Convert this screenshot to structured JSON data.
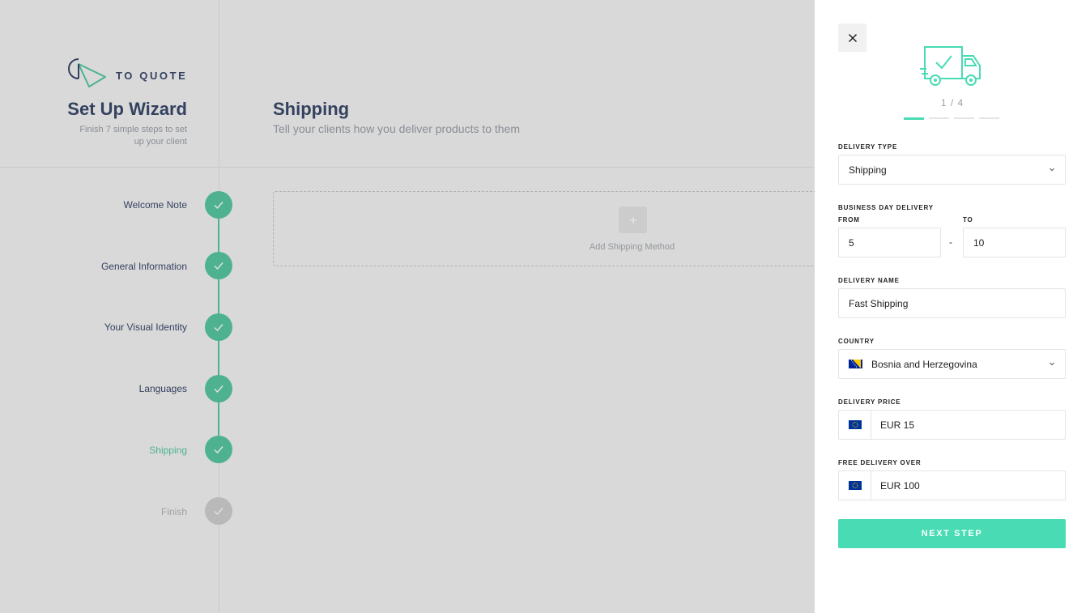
{
  "brand": {
    "logo_text": "TO QUOTE",
    "accent": "#48dbb4",
    "step_done_color": "#58c8a3",
    "navy": "#3b4a6b"
  },
  "wizard": {
    "title": "Set Up Wizard",
    "subtitle": "Finish 7 simple steps to set up your client",
    "steps": [
      {
        "label": "Welcome Note",
        "status": "done"
      },
      {
        "label": "General Information",
        "status": "done"
      },
      {
        "label": "Your Visual Identity",
        "status": "done"
      },
      {
        "label": "Languages",
        "status": "done"
      },
      {
        "label": "Shipping",
        "status": "active"
      },
      {
        "label": "Finish",
        "status": "pending"
      }
    ]
  },
  "main": {
    "title": "Shipping",
    "subtitle": "Tell your clients how you deliver products to them",
    "add_method_label": "Add Shipping Method",
    "add_icon": "plus-icon"
  },
  "drawer": {
    "close_icon": "close-icon",
    "illustration": "delivery-truck-icon",
    "counter": "1 / 4",
    "progress_current": 1,
    "progress_total": 4,
    "delivery_type": {
      "label": "DELIVERY TYPE",
      "value": "Shipping"
    },
    "business_days": {
      "label": "BUSINESS DAY DELIVERY",
      "from_label": "FROM",
      "from_value": "5",
      "separator": "-",
      "to_label": "TO",
      "to_value": "10"
    },
    "delivery_name": {
      "label": "DELIVERY NAME",
      "value": "Fast Shipping"
    },
    "country": {
      "label": "COUNTRY",
      "value": "Bosnia and Herzegovina",
      "flag_icon": "bosnia-flag-icon"
    },
    "delivery_price": {
      "label": "DELIVERY PRICE",
      "value": "EUR 15",
      "currency_icon": "eu-flag-icon"
    },
    "free_delivery": {
      "label": "FREE DELIVERY OVER",
      "value": "EUR 100",
      "currency_icon": "eu-flag-icon"
    },
    "next_button": "NEXT STEP"
  }
}
